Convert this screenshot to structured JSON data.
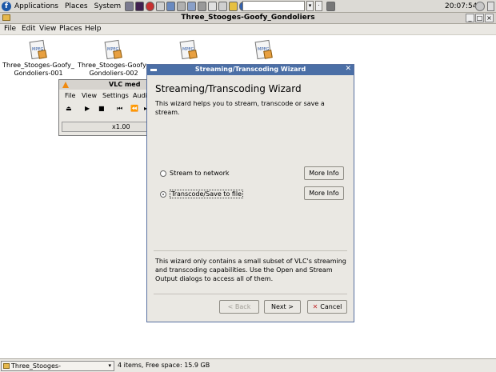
{
  "panel": {
    "menus": [
      "Applications",
      "Places",
      "System"
    ],
    "clock": "20:07:54"
  },
  "nautilus": {
    "title": "Three_Stooges-Goofy_Gondoliers",
    "menus": [
      "File",
      "Edit",
      "View",
      "Places",
      "Help"
    ],
    "files": [
      {
        "line1": "Three_Stooges-Goofy_",
        "line2": "Gondoliers-001",
        "icon_tag": "MPEG"
      },
      {
        "line1": "Three_Stooges-Goofy_",
        "line2": "Gondoliers-002",
        "icon_tag": "MPEG"
      },
      {
        "line1": "",
        "line2": "",
        "icon_tag": "MPEG"
      },
      {
        "line1": "",
        "line2": "",
        "icon_tag": "MPEG"
      }
    ],
    "location": "Three_Stooges-Goofy_Gondoliers",
    "status": "4 items, Free space: 15.9 GB"
  },
  "vlc": {
    "title": "VLC med",
    "menus": [
      "File",
      "View",
      "Settings",
      "Audi"
    ],
    "speed": "x1.00"
  },
  "wizard": {
    "title": "Streaming/Transcoding Wizard",
    "heading": "Streaming/Transcoding Wizard",
    "description": "This wizard helps you to stream, transcode or save a stream.",
    "options": [
      {
        "label": "Stream to network",
        "selected": false,
        "more_info": "More Info"
      },
      {
        "label": "Transcode/Save to file",
        "selected": true,
        "more_info": "More Info"
      }
    ],
    "footer_note": "This wizard only contains a small subset of VLC's streaming and transcoding capabilities. Use the Open and Stream Output dialogs to access all of them.",
    "back_label": "< Back",
    "next_label": "Next >",
    "cancel_label": "Cancel"
  },
  "colors": {
    "wizard_titlebar": "#4b6fa6",
    "panel": "#dcdad5"
  }
}
